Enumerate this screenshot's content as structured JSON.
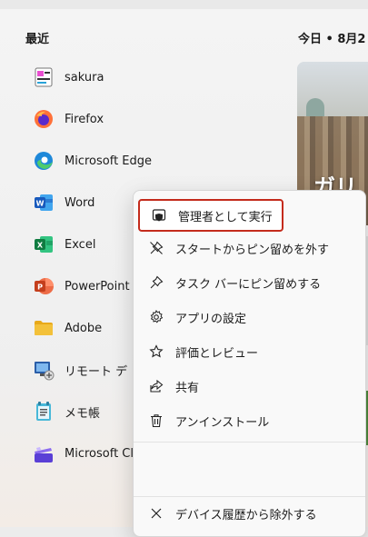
{
  "recent": {
    "title": "最近",
    "apps": [
      {
        "label": "sakura",
        "icon": "sakura-editor-icon"
      },
      {
        "label": "Firefox",
        "icon": "firefox-icon"
      },
      {
        "label": "Microsoft Edge",
        "icon": "edge-icon"
      },
      {
        "label": "Word",
        "icon": "word-icon"
      },
      {
        "label": "Excel",
        "icon": "excel-icon"
      },
      {
        "label": "PowerPoint",
        "icon": "powerpoint-icon"
      },
      {
        "label": "Adobe",
        "icon": "folder-icon"
      },
      {
        "label": "リモート デ",
        "icon": "remote-desktop-icon"
      },
      {
        "label": "メモ帳",
        "icon": "notepad-icon"
      },
      {
        "label": "Microsoft Cl",
        "icon": "clipchamp-icon"
      }
    ]
  },
  "widgets": {
    "date_label": "今日 • 8月2",
    "headline": "ガリ"
  },
  "context_menu": {
    "items": [
      {
        "label": "管理者として実行",
        "icon": "shield-icon"
      },
      {
        "label": "スタートからピン留めを外す",
        "icon": "unpin-icon"
      },
      {
        "label": "タスク バーにピン留めする",
        "icon": "pin-icon"
      },
      {
        "label": "アプリの設定",
        "icon": "gear-icon"
      },
      {
        "label": "評価とレビュー",
        "icon": "star-icon"
      },
      {
        "label": "共有",
        "icon": "share-icon"
      },
      {
        "label": "アンインストール",
        "icon": "trash-icon"
      },
      {
        "label": "デバイス履歴から除外する",
        "icon": "close-icon"
      }
    ]
  },
  "colors": {
    "selection_border": "#c42b1c",
    "word_blue": "#185abd",
    "excel_green": "#107c41",
    "powerpoint_orange": "#c43e1c",
    "folder_yellow": "#f3c13a"
  }
}
